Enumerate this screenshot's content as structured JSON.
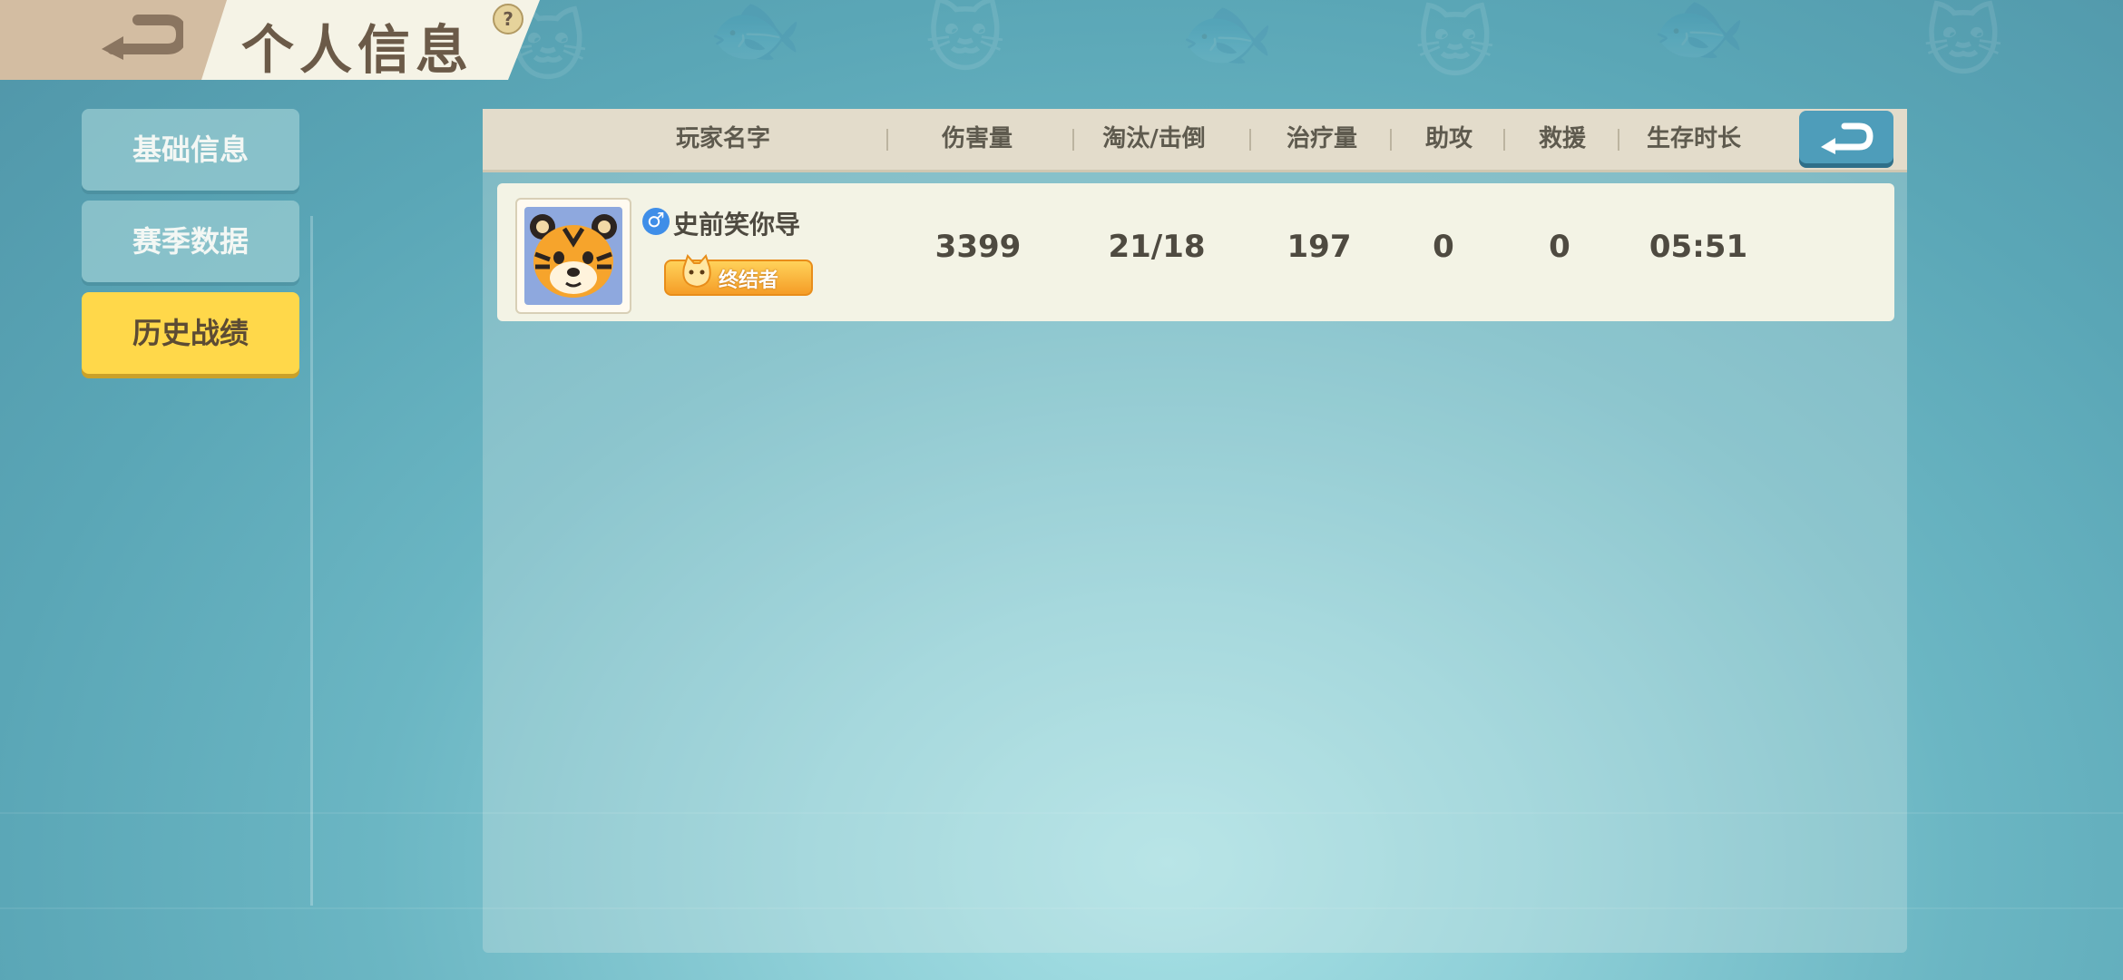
{
  "header": {
    "title": "个人信息",
    "help": "?"
  },
  "sidebar": {
    "items": [
      {
        "label": "基础信息",
        "active": false
      },
      {
        "label": "赛季数据",
        "active": false
      },
      {
        "label": "历史战绩",
        "active": true
      }
    ]
  },
  "table": {
    "columns": [
      "玩家名字",
      "伤害量",
      "淘汰/击倒",
      "治疗量",
      "助攻",
      "救援",
      "生存时长"
    ],
    "rows": [
      {
        "player_name": "史前笑你导",
        "gender": "♂",
        "title_badge": "终结者",
        "damage": "3399",
        "eliminations": "21/18",
        "healing": "197",
        "assists": "0",
        "rescues": "0",
        "survival_time": "05:51"
      }
    ]
  },
  "icons": {
    "back": "back-arrow-icon",
    "close": "return-arrow-icon",
    "avatar": "tiger-avatar-icon",
    "gender": "male-gender-icon",
    "badge": "cat-badge-icon"
  },
  "colors": {
    "active_tab": "#ffd84a",
    "header_bg": "#f5f3e6",
    "close_button": "#4e9dba"
  }
}
